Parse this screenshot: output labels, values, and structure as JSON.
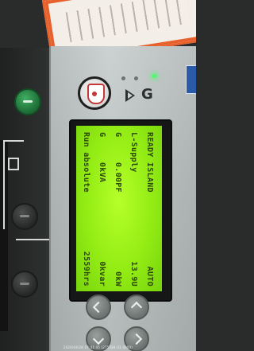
{
  "display": {
    "rows": [
      {
        "left": "READY ISLAND",
        "right": "AUTO"
      },
      {
        "left": "L-Supply",
        "right": "13.9U"
      },
      {
        "left": "G     0.00PF",
        "right": "0kW"
      },
      {
        "left": "G     0kVA",
        "right": "0kvar"
      },
      {
        "left": "Run absolute",
        "right": "2559hrs"
      }
    ]
  },
  "photo": {
    "timestamp": "2020/04/28 07:41:45 (275584-41 0000)"
  },
  "colors": {
    "lcd_backlight": "#93ec14",
    "panel": "#c9cfcf",
    "status_led": "#4dfa6d",
    "sticker_border": "#e8612c"
  },
  "icons": [
    "start-button-icon",
    "lcd-screen",
    "status-led-icon",
    "play-triangle-icon",
    "generator-symbol-icon"
  ]
}
